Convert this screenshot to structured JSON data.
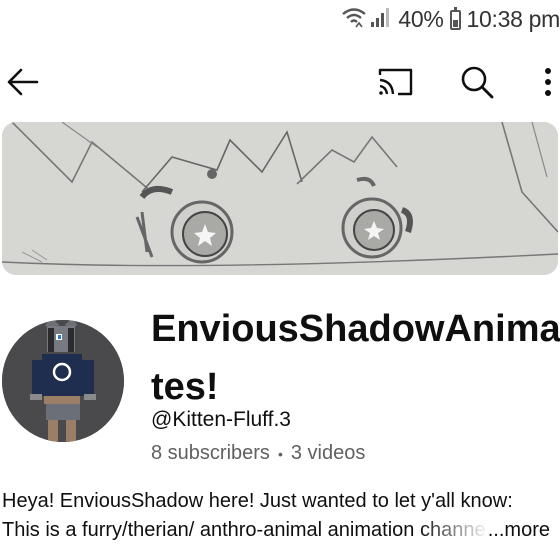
{
  "status_bar": {
    "battery": "40%",
    "time": "10:38 pm",
    "icons": [
      "wifi-icon",
      "signal-icon",
      "battery-icon"
    ]
  },
  "toolbar": {
    "icons": [
      "back-arrow-icon",
      "cast-icon",
      "search-icon",
      "more-vert-icon"
    ]
  },
  "channel": {
    "name": "EnviousShadowAnimates!",
    "handle": "@Kitten-Fluff.3",
    "subscribers": "8 subscribers",
    "separator": "•",
    "videos": "3 videos"
  },
  "description": {
    "line1": "Heya! EnviousShadow here! Just wanted to let y'all know:",
    "line2": "This is a furry/therian/ anthro-animal animation channel",
    "more": "...more"
  },
  "colors": {
    "primary_text": "#0f0f0f",
    "secondary_text": "#606060",
    "avatar_bg": "#4a4a4c",
    "banner_bg": "#d6d6d3"
  }
}
